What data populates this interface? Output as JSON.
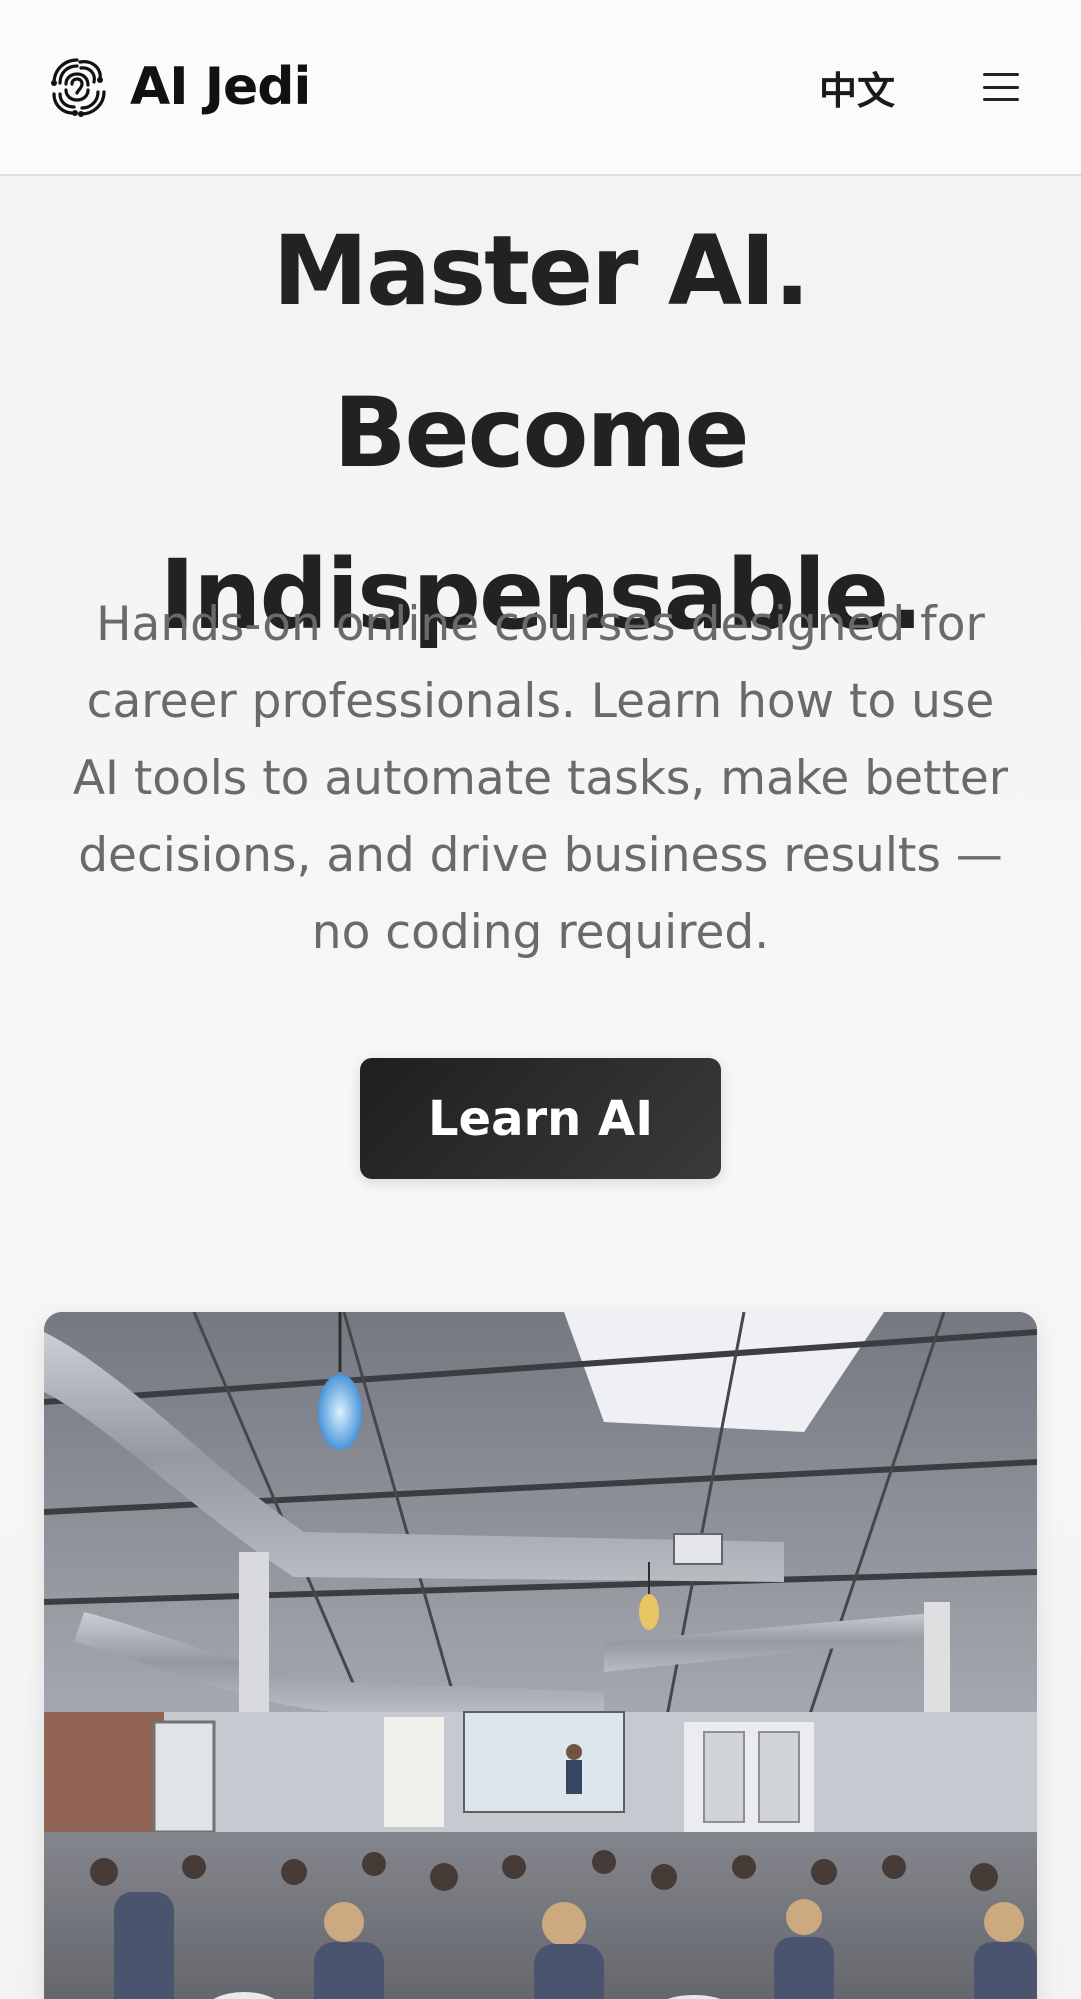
{
  "header": {
    "brand_name": "AI Jedi",
    "logo_icon": "swirl-brain-logo-icon",
    "language_link": "中文",
    "menu_icon": "hamburger-menu-icon"
  },
  "hero": {
    "title": "Master AI. Become Indispensable.",
    "subtitle": "Hands-on online courses designed for career professionals. Learn how to use AI tools to automate tasks, make better decisions, and drive business results — no coding required.",
    "cta_label": "Learn AI"
  },
  "media": {
    "photo_subject": "audience seated in an industrial-style event space watching a presenter in front of a projection screen"
  },
  "colors": {
    "background": "#f5f5f6",
    "header_bg": "#fbfbfb",
    "text_primary": "#222222",
    "text_secondary": "#6a6a6a",
    "button_bg": "#1f1f1f",
    "button_text": "#ffffff"
  }
}
